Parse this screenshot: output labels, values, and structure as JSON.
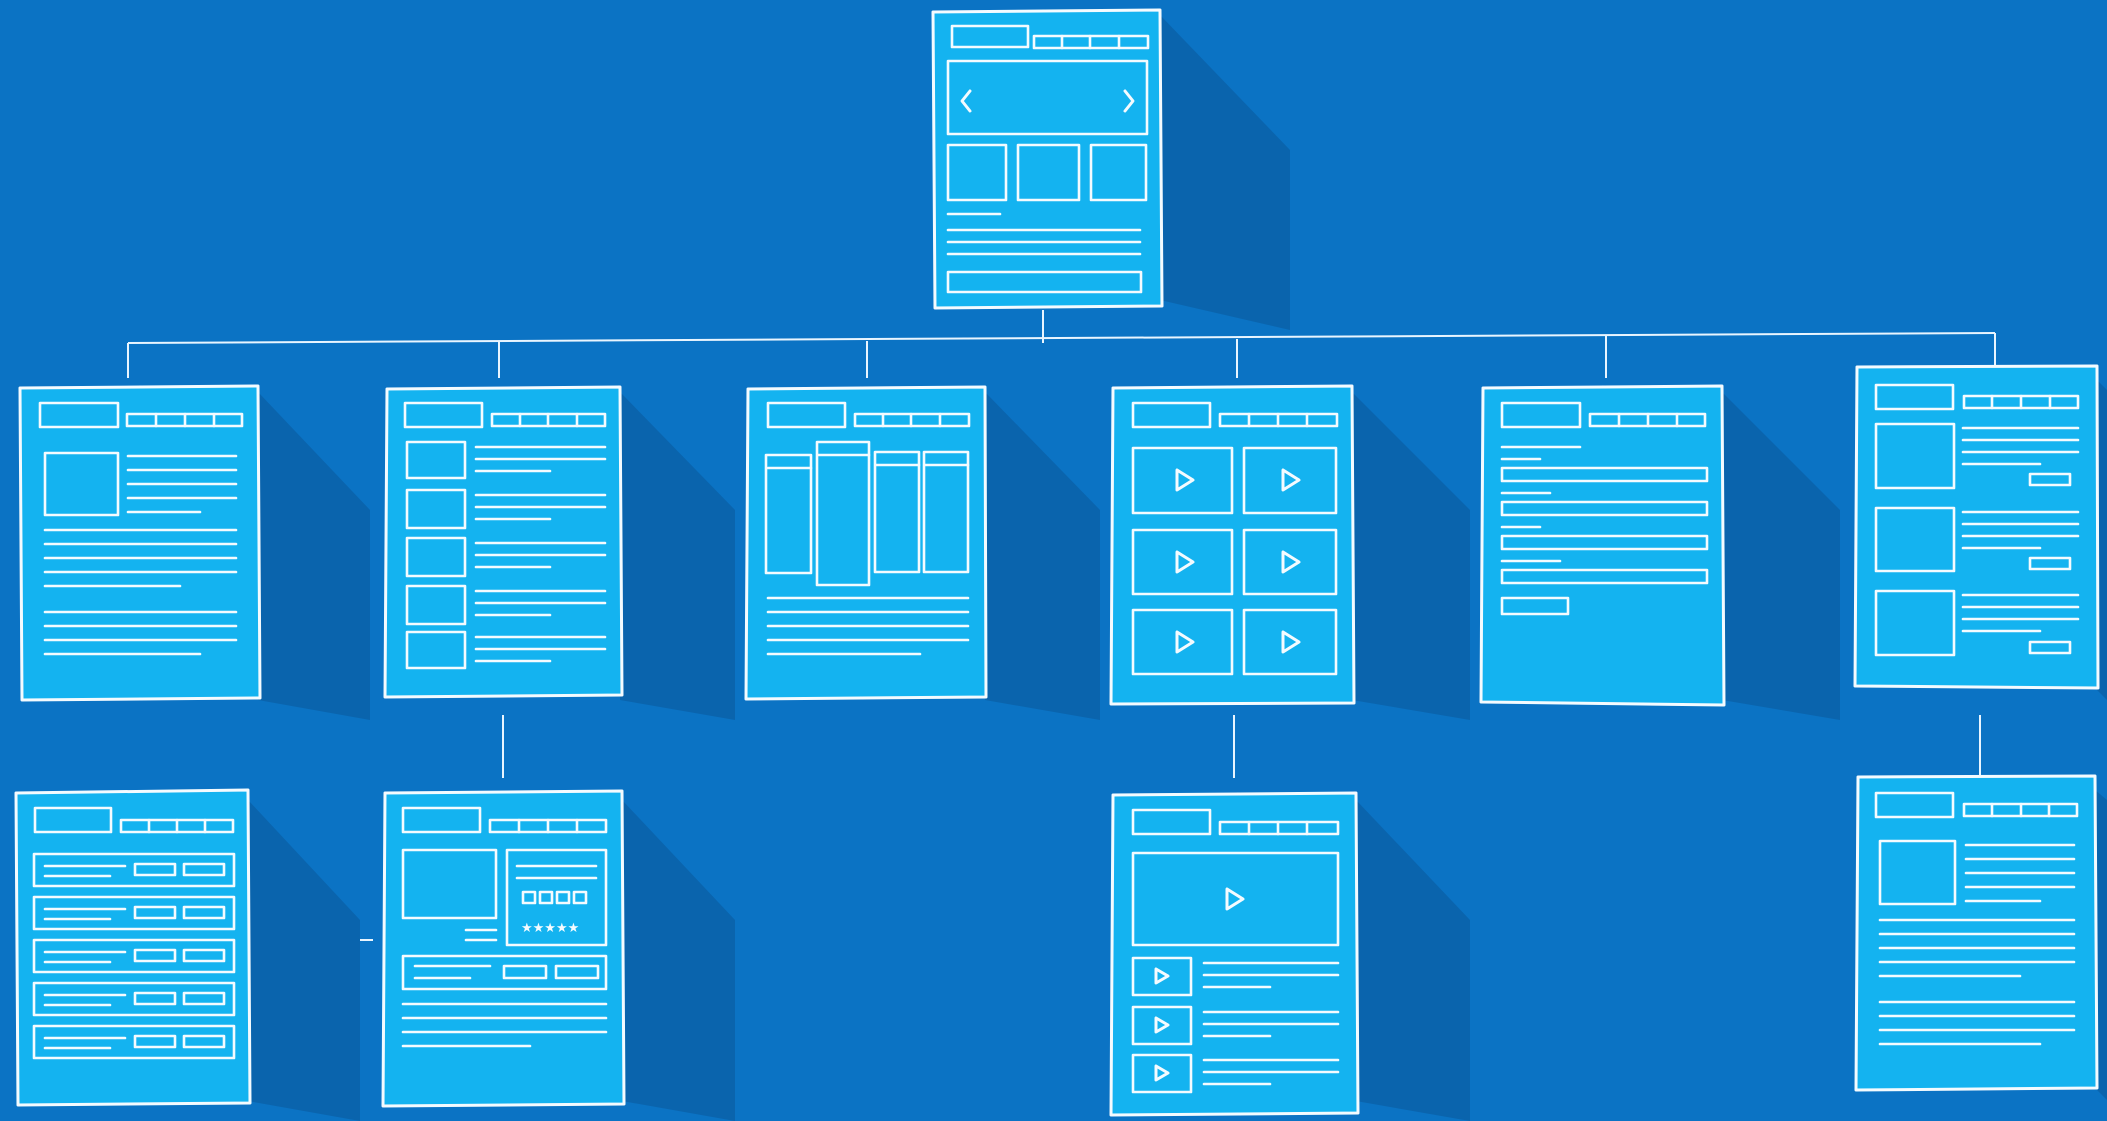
{
  "diagram": {
    "type": "sitemap-wireframes",
    "background_color": "#0b73c4",
    "page_color": "#14b3f0",
    "line_color": "#f4fbff",
    "pages": [
      {
        "id": "home",
        "kind": "home-carousel",
        "icons": [
          "chevron-left-icon",
          "chevron-right-icon"
        ]
      },
      {
        "id": "article",
        "kind": "image-article"
      },
      {
        "id": "list",
        "kind": "thumbnail-list"
      },
      {
        "id": "columns",
        "kind": "column-layout"
      },
      {
        "id": "video-grid",
        "kind": "video-grid",
        "icons": [
          "play-icon"
        ]
      },
      {
        "id": "form",
        "kind": "form-page"
      },
      {
        "id": "feature-list",
        "kind": "feature-list"
      },
      {
        "id": "table",
        "kind": "table-page"
      },
      {
        "id": "product",
        "kind": "product-detail",
        "rating_glyph": "★★★★★"
      },
      {
        "id": "video-detail",
        "kind": "video-detail",
        "icons": [
          "play-icon"
        ]
      },
      {
        "id": "detail-article",
        "kind": "image-article"
      }
    ]
  }
}
